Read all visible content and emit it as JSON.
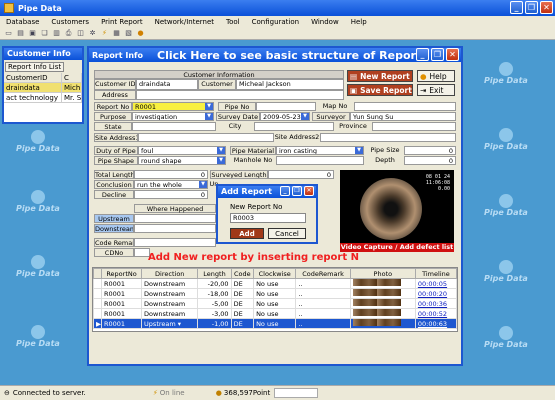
{
  "app": {
    "title": "Pipe Data"
  },
  "menu": [
    "Database",
    "Customers",
    "Print Report",
    "Network/Internet",
    "Tool",
    "Configuration",
    "Window",
    "Help"
  ],
  "toolbar_icons": [
    "new-icon",
    "open-icon",
    "save-icon",
    "copy-icon",
    "paste-icon",
    "print-icon",
    "preview-icon",
    "settings-icon",
    "lightning-icon",
    "report-icon",
    "chart-icon",
    "help-icon"
  ],
  "watermark": "Pipe Data",
  "customer_window": {
    "title": "Customer Info",
    "button": "Report Info List",
    "header": [
      "CustomerID",
      "C"
    ],
    "rows": [
      [
        "draindata",
        "Mich"
      ],
      [
        "act technology",
        "Mr. S"
      ]
    ]
  },
  "report_window": {
    "title": "Report Info",
    "banner": "Click Here to see basic structure of Report",
    "customer_section": "Customer Information",
    "customer_id_label": "Customer ID",
    "customer_id": "draindata",
    "customer_label": "Customer",
    "customer": "Micheal Jackson",
    "address_label": "Address",
    "address": "",
    "buttons": {
      "new_report": "New Report",
      "help": "Help",
      "save_report": "Save Report",
      "exit": "Exit"
    },
    "report_no_label": "Report No",
    "report_no": "R0001",
    "pipe_no_label": "Pipe No",
    "map_no_label": "Map No",
    "purpose_label": "Purpose",
    "purpose": "investigation",
    "survey_date_label": "Survey Date",
    "survey_date": "2009-05-23",
    "surveyor_label": "Surveyor",
    "surveyor": "Yun Sung Su",
    "state_label": "State",
    "city_label": "City",
    "province_label": "Province",
    "site_address1_label": "Site Address1",
    "site_address2_label": "Site Address2",
    "duty_label": "Duty of Pipe",
    "duty": "foul",
    "material_label": "Pipe Material",
    "material": "iron casting",
    "size_label": "Pipe Size",
    "size": "0",
    "shape_label": "Pipe Shape",
    "shape": "round shape",
    "manhole_label": "Manhole No",
    "depth_label": "Depth",
    "depth": "0",
    "total_length_label": "Total Length",
    "total_length": "0",
    "surveyed_length_label": "Surveyed Length",
    "surveyed_length": "0",
    "conclusion_label": "Conclusion",
    "conclusion": "run the whole",
    "un_label": "Un",
    "decline_label": "Decline",
    "decline": "0",
    "where_happened": "Where Happened",
    "upstream": "Upstream",
    "downstream": "Downstream",
    "code_remark_label": "Code Remark",
    "cdno_label": "CDNo",
    "video_caption": "Video Capture / Add defect list",
    "video_osd": [
      "08 01 24",
      "11:06:08",
      "0.00"
    ],
    "add_new_hint": "Add New report by inserting report N"
  },
  "add_dialog": {
    "title": "Add Report",
    "label": "New Report No",
    "value": "R0003",
    "add": "Add",
    "cancel": "Cancel"
  },
  "grid": {
    "columns": [
      "ReportNo",
      "Direction",
      "Length",
      "Code",
      "Clockwise",
      "CodeRemark",
      "Photo",
      "Timeline"
    ],
    "rows": [
      [
        "R0001",
        "Downstream",
        "-20,00",
        "DE",
        "No use",
        "..",
        "",
        "00:00:05"
      ],
      [
        "R0001",
        "Downstream",
        "-18,00",
        "DE",
        "No use",
        "..",
        "",
        "00:00:20"
      ],
      [
        "R0001",
        "Downstream",
        "-5,00",
        "DE",
        "No use",
        "..",
        "",
        "00:00:36"
      ],
      [
        "R0001",
        "Downstream",
        "-3,00",
        "DE",
        "No use",
        "..",
        "",
        "00:00:52"
      ],
      [
        "R0001",
        "Upstream",
        "-1,00",
        "DE",
        "No use",
        "..",
        "",
        "00:00:63"
      ]
    ]
  },
  "status": {
    "connection": "Connected to server.",
    "online": "On line",
    "points": "368,597Point"
  },
  "colors": {
    "title_blue": "#0a50d8",
    "desktop": "#4a9ad0",
    "red_button": "#b04020",
    "hint_red": "#f02020"
  }
}
